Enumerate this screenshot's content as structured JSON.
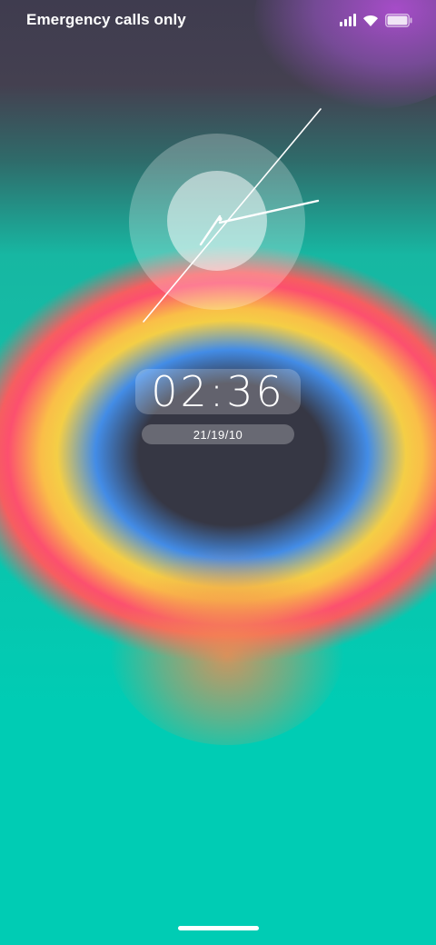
{
  "status_bar": {
    "carrier_text": "Emergency calls only",
    "signal_icon": "signal-bars-icon",
    "wifi_icon": "wifi-icon",
    "battery_icon": "battery-icon"
  },
  "clock": {
    "analog_icon": "analog-clock-icon",
    "time": "02:36",
    "date": "21/19/10"
  },
  "colors": {
    "text": "#ffffff",
    "background_bottom": "#00ccb4"
  }
}
